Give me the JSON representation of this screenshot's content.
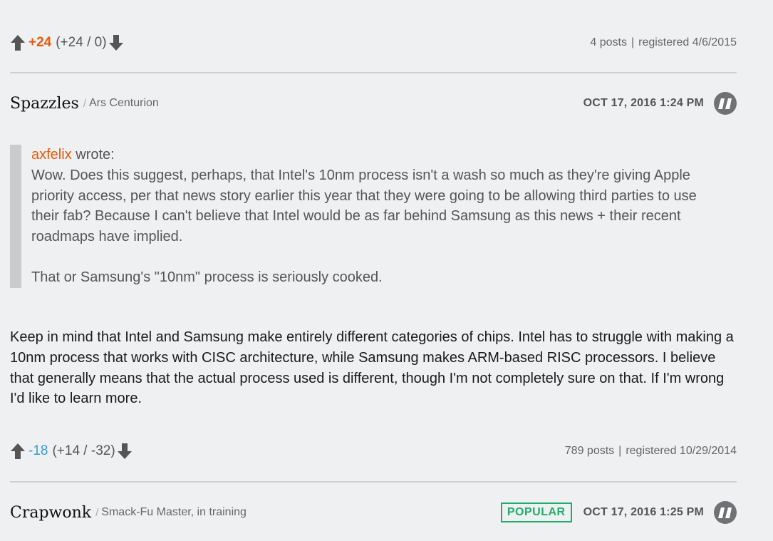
{
  "post1_footer": {
    "score": "+24",
    "breakdown": "(+24 / 0)",
    "posts": "4 posts",
    "separator": "|",
    "registered": "registered 4/6/2015"
  },
  "post2": {
    "username": "Spazzles",
    "slash": "/",
    "rank": "Ars Centurion",
    "timestamp": "OCT 17, 2016 1:24 PM",
    "quote": {
      "author": "axfelix",
      "wrote": " wrote:",
      "paragraph1": "Wow. Does this suggest, perhaps, that Intel's 10nm process isn't a wash so much as they're giving Apple priority access, per that news story earlier this year that they were going to be allowing third parties to use their fab? Because I can't believe that Intel would be as far behind Samsung as this news + their recent roadmaps have implied.",
      "paragraph2": "That or Samsung's \"10nm\" process is seriously cooked."
    },
    "body": "Keep in mind that Intel and Samsung make entirely different categories of chips. Intel has to struggle with making a 10nm process that works with CISC architecture, while Samsung makes ARM-based RISC processors. I believe that generally means that the actual process used is different, though I'm not completely sure on that. If I'm wrong I'd like to learn more.",
    "footer": {
      "score": "-18",
      "breakdown": "(+14 / -32)",
      "posts": "789 posts",
      "separator": "|",
      "registered": "registered 10/29/2014"
    }
  },
  "post3": {
    "username": "Crapwonk",
    "slash": "/",
    "rank": "Smack-Fu Master, in training",
    "badge": "POPULAR",
    "timestamp": "OCT 17, 2016 1:25 PM"
  },
  "icons": {
    "upvote": "arrow-up-icon",
    "downvote": "arrow-down-icon",
    "quote": "quote-icon"
  },
  "colors": {
    "positive_score": "#e8590c",
    "negative_score": "#3a9bd1",
    "popular_badge": "#1fae6a",
    "quote_bar": "#cbcbcb",
    "background": "#eff0f1"
  }
}
